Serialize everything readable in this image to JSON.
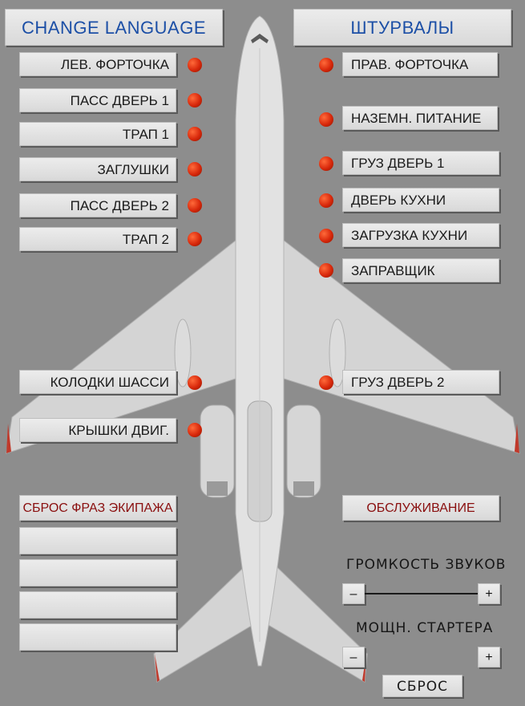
{
  "header": {
    "language_button": "CHANGE LANGUAGE",
    "yokes_button": "ШТУРВАЛЫ"
  },
  "left_buttons": [
    "ЛЕВ. ФОРТОЧКА",
    "ПАСС ДВЕРЬ 1",
    "ТРАП 1",
    "ЗАГЛУШКИ",
    "ПАСС ДВЕРЬ 2",
    "ТРАП 2",
    "КОЛОДКИ ШАССИ",
    "КРЫШКИ ДВИГ."
  ],
  "right_buttons": [
    "ПРАВ. ФОРТОЧКА",
    "НАЗЕМН. ПИТАНИЕ",
    "ГРУЗ ДВЕРЬ 1",
    "ДВЕРЬ КУХНИ",
    "ЗАГРУЗКА КУХНИ",
    "ЗАПРАВЩИК",
    "ГРУЗ ДВЕРЬ 2"
  ],
  "crew": {
    "reset_phrases": "СБРОС ФРАЗ ЭКИПАЖА"
  },
  "service": {
    "label": "ОБСЛУЖИВАНИЕ"
  },
  "sound": {
    "label": "ГРОМКОСТЬ ЗВУКОВ",
    "minus": "–",
    "plus": "+"
  },
  "starter": {
    "label": "МОЩН. СТАРТЕРА",
    "minus": "–",
    "plus": "+"
  },
  "reset": {
    "label": "СБРОС"
  },
  "colors": {
    "indicator": "#d8280b",
    "language_text": "#1c4fa6",
    "crew_text": "#8a0f0f"
  }
}
